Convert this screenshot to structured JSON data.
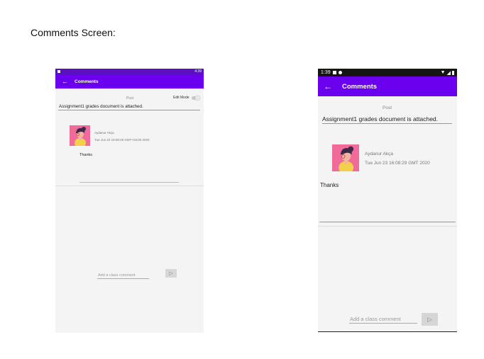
{
  "document": {
    "title": "Comments Screen:"
  },
  "screens": [
    {
      "status_time": "4:39",
      "app_title": "Comments",
      "post_label": "Post",
      "edit_mode_label": "Edit Mode",
      "post_text": "Assignment1 grades document is attached.",
      "author": "Aydanur Akça",
      "date": "Tue Jun 23 19:08:29 GMT+03:00 2020",
      "comment_text": "Thanks",
      "add_comment_placeholder": "Add a class comment"
    },
    {
      "status_time": "1:39",
      "app_title": "Comments",
      "post_label": "Post",
      "post_text": "Assignment1 grades document is attached.",
      "author": "Aydanur Akça",
      "date": "Tue Jun 23 16:08:29 GMT 2020",
      "comment_text": "Thanks",
      "add_comment_placeholder": "Add a class comment"
    }
  ],
  "icons": {
    "back": "arrow-left-icon",
    "send": "send-icon",
    "wifi": "wifi-icon",
    "signal": "signal-icon",
    "battery": "battery-icon"
  },
  "colors": {
    "app_bar": "#6a00ee",
    "status_bar_a": "#5a0fc0",
    "status_bar_b": "#151515",
    "avatar_bg": "#f06b9a",
    "background": "#f4f4f4"
  }
}
